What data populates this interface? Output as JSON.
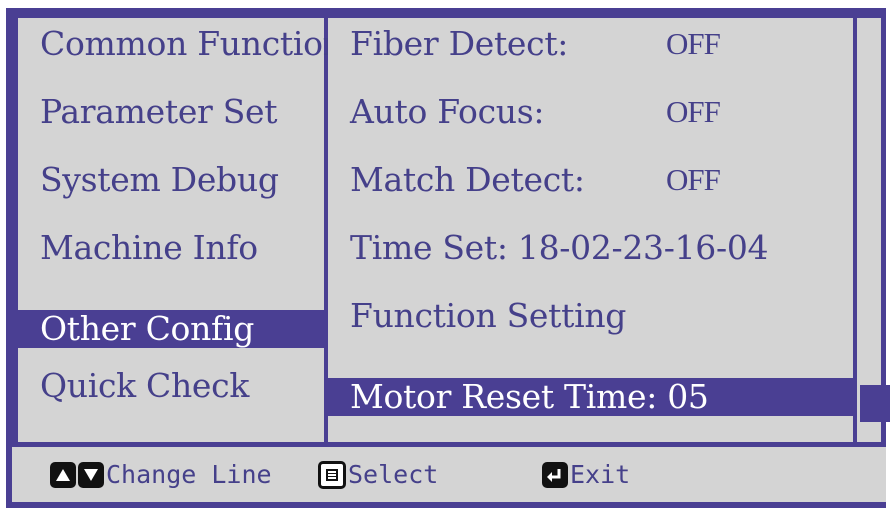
{
  "menu": {
    "items": [
      {
        "label": "Common Function",
        "selected": false
      },
      {
        "label": "Parameter Set",
        "selected": false
      },
      {
        "label": "System Debug",
        "selected": false
      },
      {
        "label": "Machine Info",
        "selected": false
      },
      {
        "label": "Other Config",
        "selected": true
      },
      {
        "label": "Quick Check",
        "selected": false
      }
    ]
  },
  "settings": {
    "rows": [
      {
        "label": "Fiber Detect:",
        "value": "OFF",
        "selected": false
      },
      {
        "label": "Auto Focus:",
        "value": "OFF",
        "selected": false
      },
      {
        "label": "Match Detect:",
        "value": "OFF",
        "selected": false
      },
      {
        "label": "Time Set: 18-02-23-16-04",
        "value": "",
        "selected": false
      },
      {
        "label": "Function Setting",
        "value": "",
        "selected": false
      },
      {
        "label": "Motor Reset Time: 05",
        "value": "",
        "selected": true
      }
    ]
  },
  "status_bar": {
    "change_line": {
      "icons": [
        "up-arrow-icon",
        "down-arrow-icon"
      ],
      "label": "Change Line"
    },
    "select": {
      "icon": "menu-icon",
      "label": "Select"
    },
    "exit": {
      "icon": "return-icon",
      "label": "Exit"
    }
  },
  "colors": {
    "frame": "#4a3f93",
    "panel": "#d4d4d4",
    "text": "#45408a",
    "selected_text": "#ffffff"
  }
}
